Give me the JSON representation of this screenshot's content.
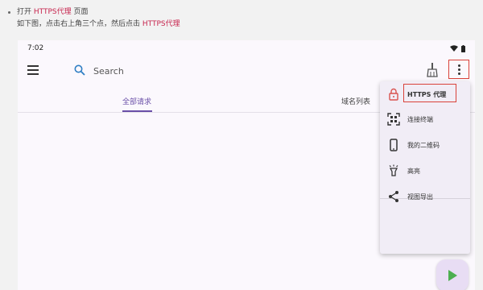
{
  "doc": {
    "line1_prefix": "打开",
    "line1_highlight": "HTTPS代理",
    "line1_suffix": "页面",
    "line2_prefix": "如下图，点击右上角三个点，然后点击",
    "line2_highlight": "HTTPS代理"
  },
  "status": {
    "time": "7:02"
  },
  "appbar": {
    "search_label": "Search"
  },
  "tabs": [
    {
      "label": "全部请求"
    },
    {
      "label": "域名列表"
    }
  ],
  "menu": {
    "items": [
      {
        "label": "HTTPS 代理",
        "icon": "lock-icon"
      },
      {
        "label": "连接终端",
        "icon": "qr-scan-icon"
      },
      {
        "label": "我的二维码",
        "icon": "phone-icon"
      },
      {
        "label": "高亮",
        "icon": "highlight-icon"
      },
      {
        "label": "视图导出",
        "icon": "share-icon"
      }
    ]
  },
  "colors": {
    "accent": "#6a4fa8",
    "annotation": "#d9423a",
    "highlight_text": "#c7254e",
    "fab": "#4caf50"
  }
}
